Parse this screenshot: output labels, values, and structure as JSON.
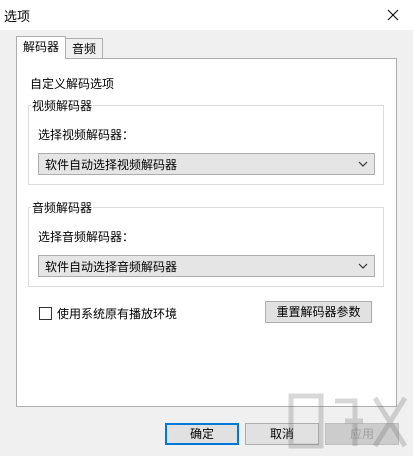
{
  "window": {
    "title": "选项"
  },
  "tabs": [
    {
      "label": "解码器",
      "active": true
    },
    {
      "label": "音频",
      "active": false
    }
  ],
  "panel": {
    "section_title": "自定义解码选项",
    "video_group": {
      "legend": "视频解码器",
      "label": "选择视频解码器：",
      "selected": "软件自动选择视频解码器"
    },
    "audio_group": {
      "legend": "音频解码器",
      "label": "选择音频解码器：",
      "selected": "软件自动选择音频解码器"
    },
    "use_system_env": {
      "label": "使用系统原有播放环境",
      "checked": false
    },
    "reset_button": "重置解码器参数"
  },
  "footer": {
    "ok": "确定",
    "cancel": "取消",
    "apply": "应用"
  },
  "icons": {
    "close": "close-icon",
    "dropdown": "chevron-down-icon"
  },
  "colors": {
    "accent": "#0078d7"
  }
}
